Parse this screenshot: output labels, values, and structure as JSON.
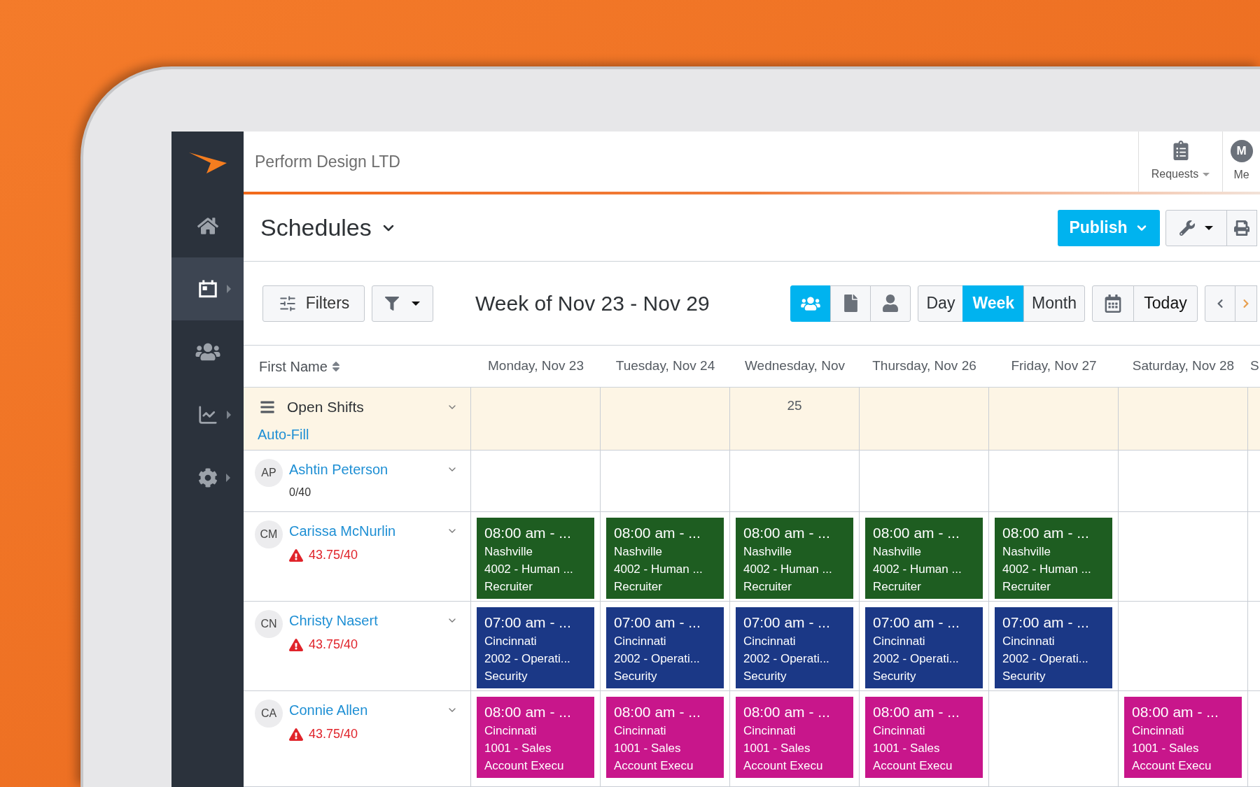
{
  "top_bar": {
    "company": "Perform Design LTD",
    "requests": "Requests",
    "me": {
      "label": "Me",
      "initials": "M"
    }
  },
  "sidebar": {
    "items": [
      {
        "selected": false,
        "submenu": false
      },
      {
        "selected": true,
        "submenu": true
      },
      {
        "selected": false,
        "submenu": false
      },
      {
        "selected": false,
        "submenu": true
      },
      {
        "selected": false,
        "submenu": true
      }
    ]
  },
  "header": {
    "title": "Schedules",
    "publish": "Publish"
  },
  "toolbar": {
    "filters": "Filters",
    "week_title": "Week of Nov 23 - Nov 29",
    "views": [
      {
        "selected": true
      },
      {
        "selected": false
      },
      {
        "selected": false
      }
    ],
    "ranges": [
      {
        "label": "Day",
        "selected": false
      },
      {
        "label": "Week",
        "selected": true
      },
      {
        "label": "Month",
        "selected": false
      }
    ],
    "today": "Today"
  },
  "table": {
    "name_column": "First Name",
    "day_columns": [
      {
        "label": "Monday, Nov 23"
      },
      {
        "label": "Tuesday, Nov 24"
      },
      {
        "label": "Wednesday, Nov",
        "label_overflow": "25"
      },
      {
        "label": "Thursday, Nov 26"
      },
      {
        "label": "Friday, Nov 27"
      },
      {
        "label": "Saturday, Nov 28"
      },
      {
        "label": "S"
      }
    ],
    "open_shifts": {
      "label": "Open Shifts",
      "action": "Auto-Fill"
    },
    "rows": [
      {
        "initials": "AP",
        "name": "Ashtin Peterson",
        "hours": "0/40",
        "over_limit": false,
        "cells": [
          {
            "kind": "empty"
          },
          {
            "kind": "empty"
          },
          {
            "kind": "empty"
          },
          {
            "kind": "empty"
          },
          {
            "kind": "empty"
          },
          {
            "kind": "empty"
          },
          {
            "kind": "empty"
          }
        ]
      },
      {
        "initials": "CM",
        "name": "Carissa McNurlin",
        "hours": "43.75/40",
        "over_limit": true,
        "cells": [
          {
            "kind": "shift",
            "time": "08:00 am - ...",
            "location": "Nashville",
            "department": "4002 - Human ...",
            "position": "Recruiter",
            "color": "#1e5d21"
          },
          {
            "kind": "shift",
            "time": "08:00 am - ...",
            "location": "Nashville",
            "department": "4002 - Human ...",
            "position": "Recruiter",
            "color": "#1e5d21"
          },
          {
            "kind": "shift",
            "time": "08:00 am - ...",
            "location": "Nashville",
            "department": "4002 - Human ...",
            "position": "Recruiter",
            "color": "#1e5d21"
          },
          {
            "kind": "shift",
            "time": "08:00 am - ...",
            "location": "Nashville",
            "department": "4002 - Human ...",
            "position": "Recruiter",
            "color": "#1e5d21"
          },
          {
            "kind": "shift",
            "time": "08:00 am - ...",
            "location": "Nashville",
            "department": "4002 - Human ...",
            "position": "Recruiter",
            "color": "#1e5d21"
          },
          {
            "kind": "empty"
          },
          {
            "kind": "empty"
          }
        ]
      },
      {
        "initials": "CN",
        "name": "Christy Nasert",
        "hours": "43.75/40",
        "over_limit": true,
        "cells": [
          {
            "kind": "shift",
            "time": "07:00 am - ...",
            "location": "Cincinnati",
            "department": "2002 - Operati...",
            "position": "Security",
            "color": "#1b3886"
          },
          {
            "kind": "shift",
            "time": "07:00 am - ...",
            "location": "Cincinnati",
            "department": "2002 - Operati...",
            "position": "Security",
            "color": "#1b3886"
          },
          {
            "kind": "shift",
            "time": "07:00 am - ...",
            "location": "Cincinnati",
            "department": "2002 - Operati...",
            "position": "Security",
            "color": "#1b3886"
          },
          {
            "kind": "shift",
            "time": "07:00 am - ...",
            "location": "Cincinnati",
            "department": "2002 - Operati...",
            "position": "Security",
            "color": "#1b3886"
          },
          {
            "kind": "shift",
            "time": "07:00 am - ...",
            "location": "Cincinnati",
            "department": "2002 - Operati...",
            "position": "Security",
            "color": "#1b3886"
          },
          {
            "kind": "empty"
          },
          {
            "kind": "empty"
          }
        ]
      },
      {
        "initials": "CA",
        "name": "Connie Allen",
        "hours": "43.75/40",
        "over_limit": true,
        "cells": [
          {
            "kind": "shift",
            "time": "08:00 am - ...",
            "location": "Cincinnati",
            "department": "1001 - Sales",
            "position": "Account Execu",
            "color": "#c8168b"
          },
          {
            "kind": "shift",
            "time": "08:00 am - ...",
            "location": "Cincinnati",
            "department": "1001 - Sales",
            "position": "Account Execu",
            "color": "#c8168b"
          },
          {
            "kind": "shift",
            "time": "08:00 am - ...",
            "location": "Cincinnati",
            "department": "1001 - Sales",
            "position": "Account Execu",
            "color": "#c8168b"
          },
          {
            "kind": "shift",
            "time": "08:00 am - ...",
            "location": "Cincinnati",
            "department": "1001 - Sales",
            "position": "Account Execu",
            "color": "#c8168b"
          },
          {
            "kind": "empty"
          },
          {
            "kind": "shift",
            "time": "08:00 am - ...",
            "location": "Cincinnati",
            "department": "1001 - Sales",
            "position": "Account Execu",
            "color": "#c8168b"
          },
          {
            "kind": "empty"
          }
        ]
      }
    ]
  }
}
